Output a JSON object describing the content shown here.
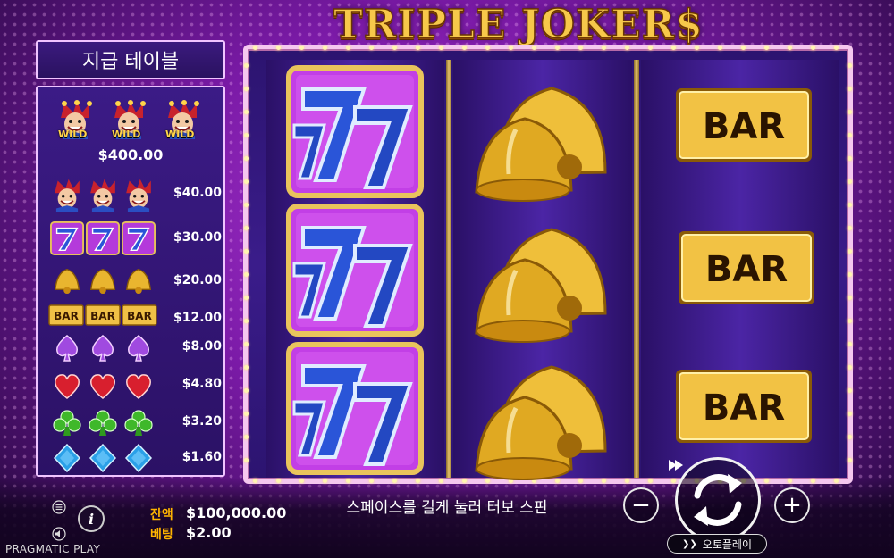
{
  "game": {
    "title": "TRIPLE JOKER$",
    "brand": "PRAGMATIC PLAY"
  },
  "paytable": {
    "header": "지급 테이블",
    "wild_label": "WILD",
    "top_value": "$400.00",
    "rows": [
      {
        "symbol": "joker-icon",
        "value": "$40.00"
      },
      {
        "symbol": "seven-icon",
        "value": "$30.00"
      },
      {
        "symbol": "bell-icon",
        "value": "$20.00"
      },
      {
        "symbol": "bar-icon",
        "value": "$12.00",
        "label": "BAR"
      },
      {
        "symbol": "spade-icon",
        "value": "$8.00"
      },
      {
        "symbol": "heart-icon",
        "value": "$4.80"
      },
      {
        "symbol": "club-icon",
        "value": "$3.20"
      },
      {
        "symbol": "diamond-icon",
        "value": "$1.60"
      }
    ]
  },
  "reels": [
    [
      "seven-icon",
      "seven-icon",
      "seven-icon"
    ],
    [
      "bell-icon",
      "bell-icon",
      "bell-icon"
    ],
    [
      "bar-icon",
      "bar-icon",
      "bar-icon"
    ]
  ],
  "bar_label": "BAR",
  "hud": {
    "balance_label": "잔액",
    "balance_value": "$100,000.00",
    "bet_label": "베팅",
    "bet_value": "$2.00",
    "turbo_message": "스페이스를 길게 눌러 터보 스핀",
    "minus_label": "−",
    "plus_label": "+",
    "autoplay_label": "오토플레이",
    "info_label": "i"
  },
  "colors": {
    "accent_gold": "#f7c84a",
    "balance_label": "#ffb400",
    "frame": "#f5c7ef",
    "panel": "#3b1b86"
  }
}
